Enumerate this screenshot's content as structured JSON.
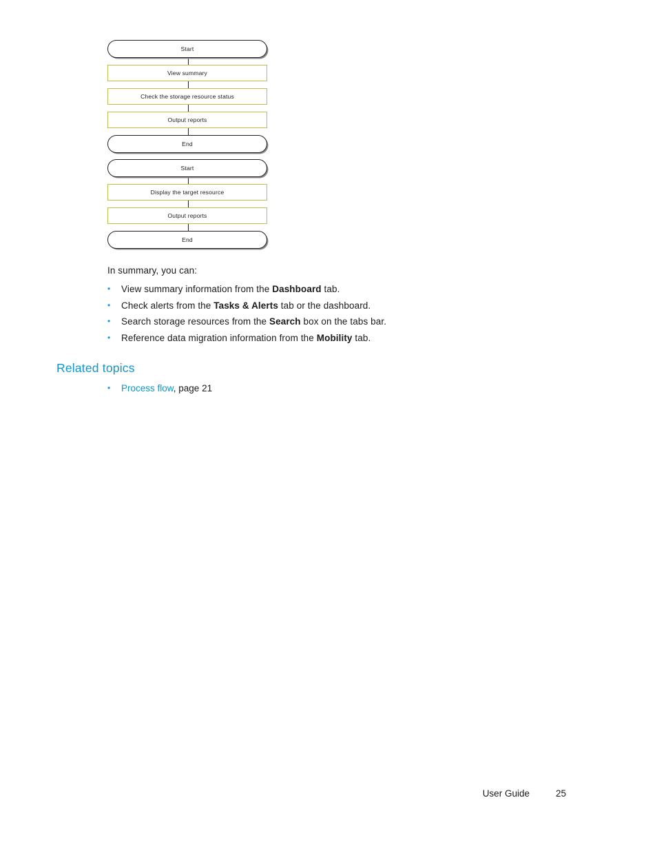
{
  "document": {
    "footer": {
      "label": "User Guide",
      "page_number": "25"
    }
  },
  "flowcharts": [
    {
      "name": "summary-and-status-flow",
      "nodes": [
        {
          "type": "terminal",
          "label": "Start"
        },
        {
          "type": "process",
          "label": "View summary"
        },
        {
          "type": "process",
          "label": "Check the storage resource status"
        },
        {
          "type": "process",
          "label": "Output reports"
        },
        {
          "type": "terminal",
          "label": "End"
        }
      ]
    },
    {
      "name": "target-resource-flow",
      "nodes": [
        {
          "type": "terminal",
          "label": "Start"
        },
        {
          "type": "process",
          "label": "Display the target resource"
        },
        {
          "type": "process",
          "label": "Output reports"
        },
        {
          "type": "terminal",
          "label": "End"
        }
      ]
    }
  ],
  "body": {
    "intro": "In summary, you can:",
    "bullets": [
      {
        "marker": "•",
        "parts": [
          {
            "text": "View summary information from the ",
            "bold": false
          },
          {
            "text": "Dashboard",
            "bold": true
          },
          {
            "text": " tab.",
            "bold": false
          }
        ]
      },
      {
        "marker": "•",
        "parts": [
          {
            "text": "Check alerts from the ",
            "bold": false
          },
          {
            "text": "Tasks & Alerts",
            "bold": true
          },
          {
            "text": " tab or the dashboard.",
            "bold": false
          }
        ]
      },
      {
        "marker": "•",
        "parts": [
          {
            "text": "Search storage resources from the ",
            "bold": false
          },
          {
            "text": "Search",
            "bold": true
          },
          {
            "text": " box on the tabs bar.",
            "bold": false
          }
        ]
      },
      {
        "marker": "•",
        "parts": [
          {
            "text": "Reference data migration information from the ",
            "bold": false
          },
          {
            "text": "Mobility",
            "bold": true
          },
          {
            "text": " tab.",
            "bold": false
          }
        ]
      }
    ]
  },
  "related_topics": {
    "heading": "Related topics",
    "items": [
      {
        "marker": "•",
        "link_text": "Process flow",
        "suffix": ", page 21"
      }
    ]
  },
  "colors": {
    "link_blue": "#0e95d3",
    "bullet_blue": "#0e9bd7",
    "process_border_olive": "#c0bf4c",
    "terminal_border_black": "#231f20",
    "terminal_shadow_gray": "#8c8c8c",
    "text_black": "#1a1a1a"
  }
}
